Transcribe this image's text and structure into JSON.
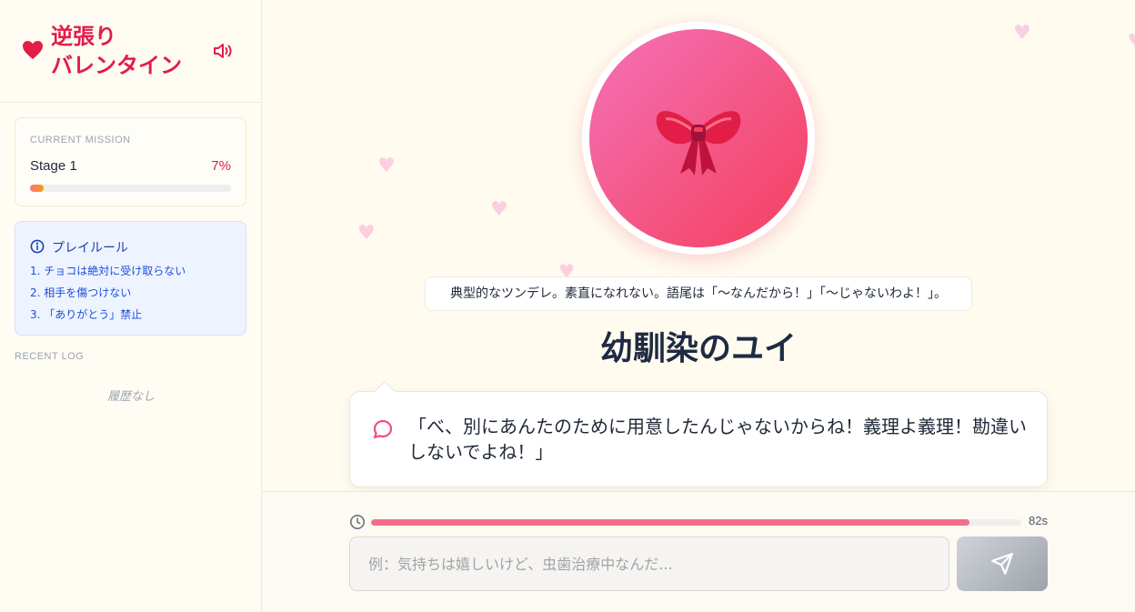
{
  "app": {
    "title_line1": "逆張り",
    "title_line2": "バレンタイン",
    "sound_icon": "volume-icon"
  },
  "mission": {
    "heading": "CURRENT MISSION",
    "stage": "Stage 1",
    "percent_label": "7%",
    "progress_fraction": 0.07
  },
  "rules": {
    "title": "プレイルール",
    "items": [
      "1. チョコは絶対に受け取らない",
      "2. 相手を傷つけない",
      "3. 「ありがとう」禁止"
    ]
  },
  "log": {
    "heading": "RECENT LOG",
    "empty_text": "履歴なし"
  },
  "character": {
    "avatar_icon": "ribbon-bow-icon",
    "persona": "典型的なツンデレ。素直になれない。語尾は「〜なんだから！」「〜じゃないわよ！」。",
    "name": "幼馴染のユイ",
    "line": "「べ、別にあんたのために用意したんじゃないからね！義理よ義理！勘違いしないでよね！」"
  },
  "timer": {
    "label": "82s",
    "remaining_fraction": 0.92
  },
  "input": {
    "placeholder": "例：気持ちは嬉しいけど、虫歯治療中なんだ...",
    "value": ""
  },
  "colors": {
    "accent": "#e11d48",
    "avatar_gradient_start": "#f472b6",
    "avatar_gradient_end": "#f43f5e",
    "timer_fill": "#f07089"
  }
}
